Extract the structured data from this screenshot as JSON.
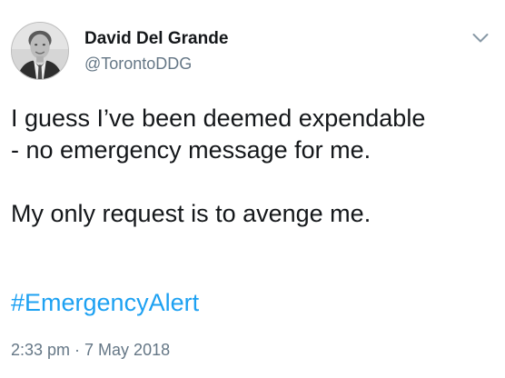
{
  "tweet": {
    "author": {
      "name": "David Del Grande",
      "handle": "@TorontoDDG"
    },
    "menu_icon": "chevron-down-icon",
    "text": {
      "line1": "I guess I’ve been deemed expendable",
      "line2": "- no emergency message for me.",
      "line3": "My only request is to avenge me."
    },
    "hashtag": "#EmergencyAlert",
    "timestamp": "2:33 pm · 7 May 2018"
  },
  "colors": {
    "text": "#14171a",
    "secondary": "#657786",
    "link": "#1da1f2",
    "chevron": "#8899a6"
  }
}
